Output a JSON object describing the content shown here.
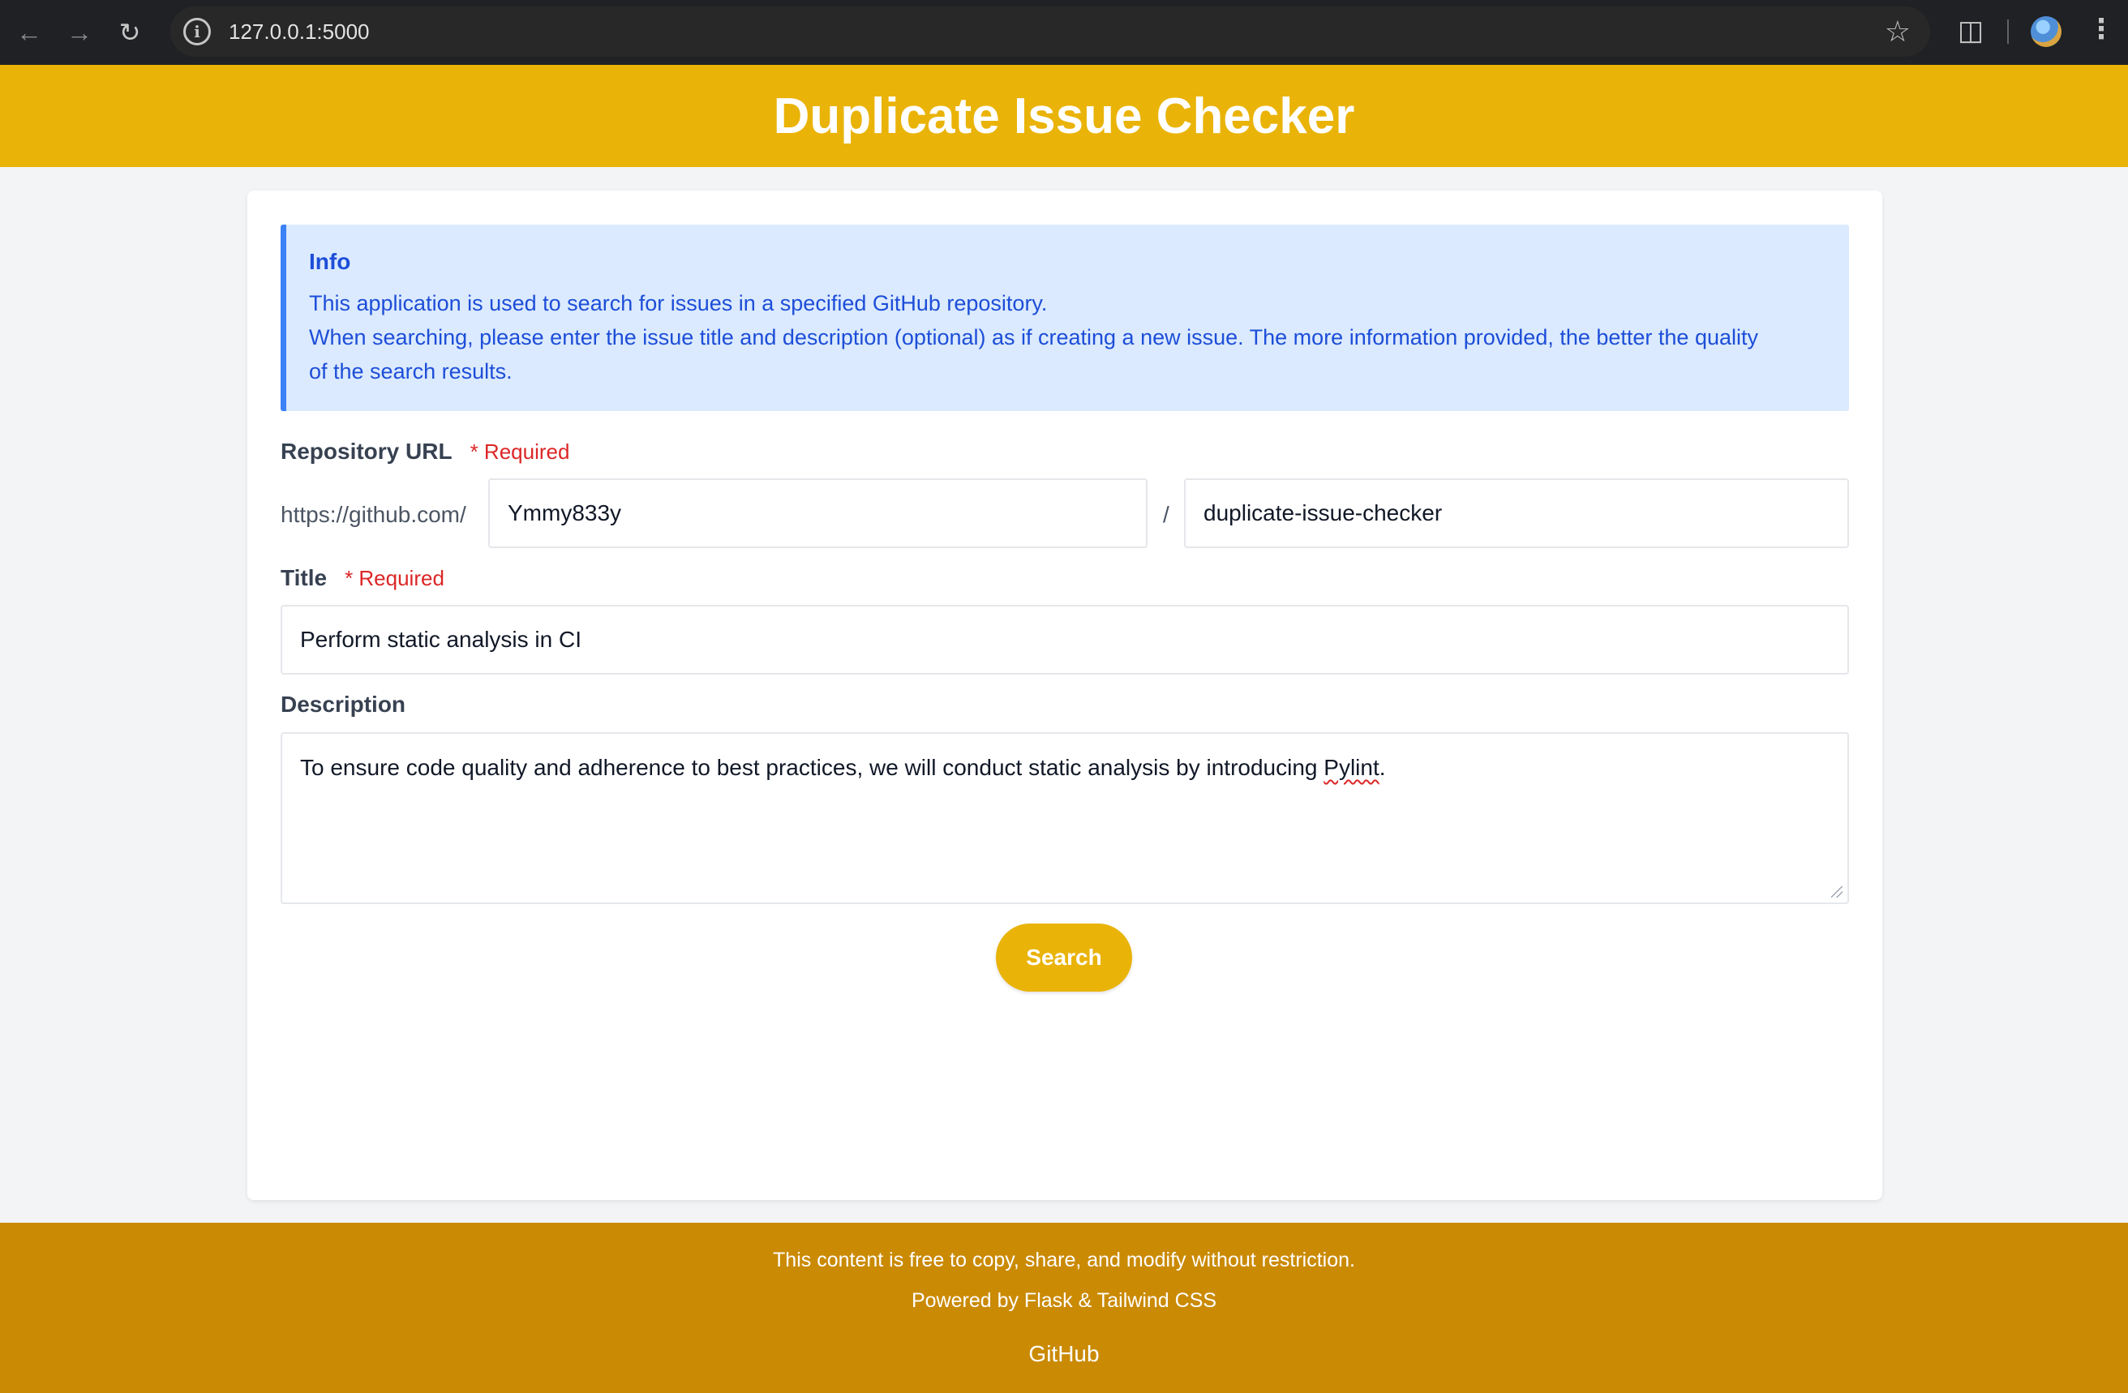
{
  "browser": {
    "url": "127.0.0.1:5000",
    "icons": [
      "back-arrow-icon",
      "forward-arrow-icon",
      "reload-icon",
      "site-info-icon",
      "bookmark-star-icon",
      "extensions-icon",
      "profile-avatar",
      "menu-icon"
    ]
  },
  "header": {
    "title": "Duplicate Issue Checker"
  },
  "info": {
    "title": "Info",
    "line1": "This application is used to search for issues in a specified GitHub repository.",
    "line2": "When searching, please enter the issue title and description (optional) as if creating a new issue. The more information provided, the better the quality",
    "line3": "of the search results."
  },
  "form": {
    "repo_label": "Repository URL",
    "required_label": "* Required",
    "repo_prefix": "https://github.com/",
    "owner_value": "Ymmy833y",
    "separator": "/",
    "repo_value": "duplicate-issue-checker",
    "title_label": "Title",
    "title_value": "Perform static analysis in CI",
    "description_label": "Description",
    "description_before": "To ensure code quality and adherence to best practices, we will conduct static analysis by introducing ",
    "description_flagged": "Pylint",
    "description_after": ".",
    "search_label": "Search"
  },
  "footer": {
    "license": "This content is free to copy, share, and modify without restriction.",
    "powered": "Powered by Flask & Tailwind CSS",
    "github_link": "GitHub"
  },
  "colors": {
    "header": "#eab308",
    "footer": "#ca8a04",
    "info_bg": "#dbeafe",
    "info_text": "#1d4ed8",
    "required": "#dc2626"
  }
}
